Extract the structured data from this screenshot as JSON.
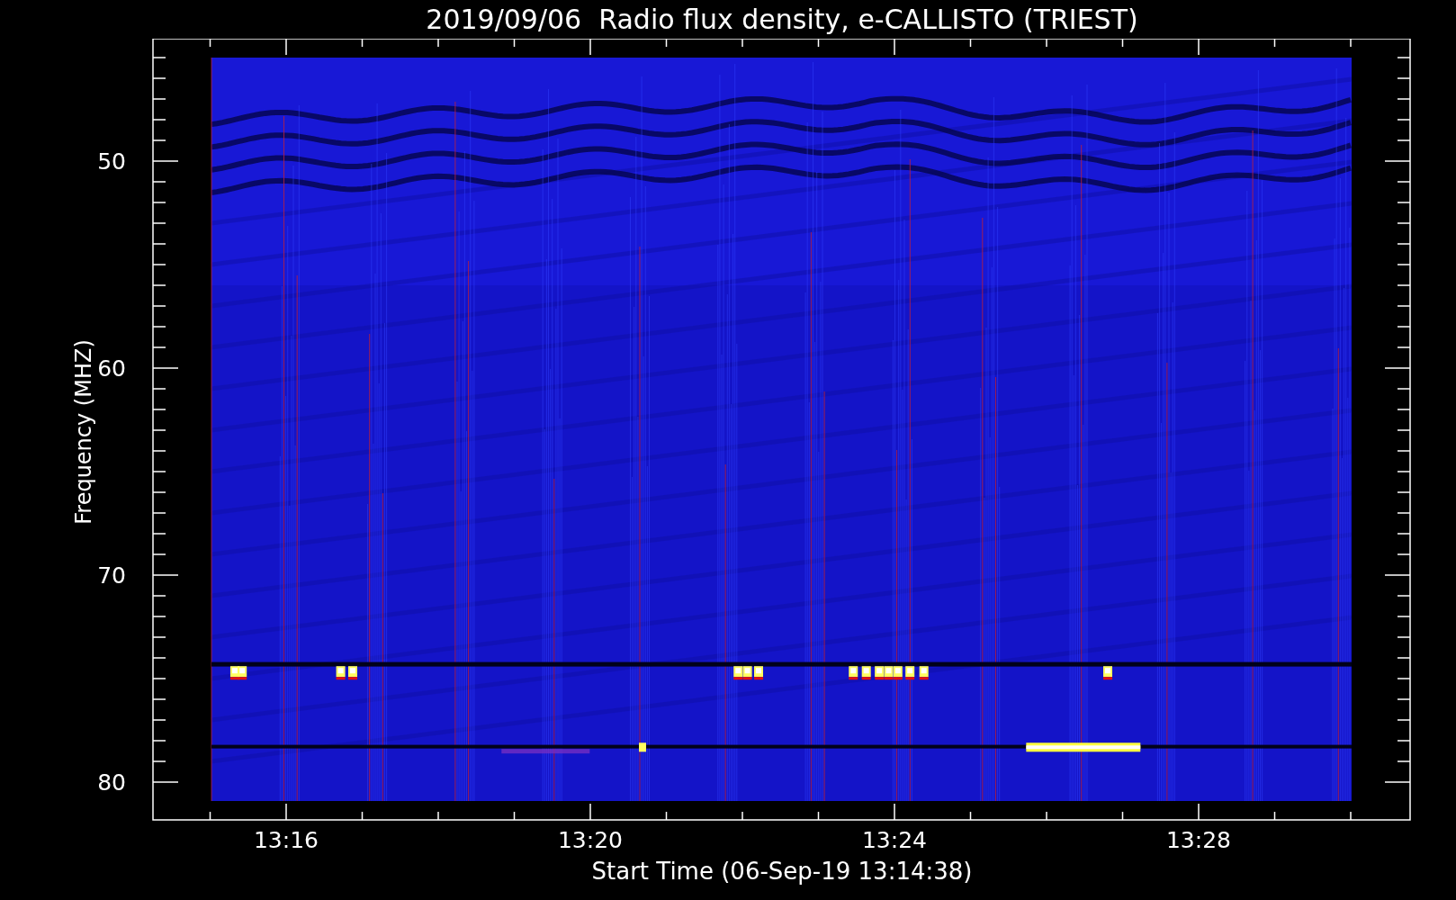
{
  "chart": {
    "title": "2019/09/06  Radio flux density, e-CALLISTO (TRIEST)",
    "xlabel": "Start Time (06-Sep-19 13:14:38)",
    "ylabel": "Frequency (MHZ)",
    "xticks": [
      "13:16",
      "13:20",
      "13:24",
      "13:28"
    ],
    "yticks": [
      "50",
      "60",
      "70",
      "80"
    ]
  }
}
